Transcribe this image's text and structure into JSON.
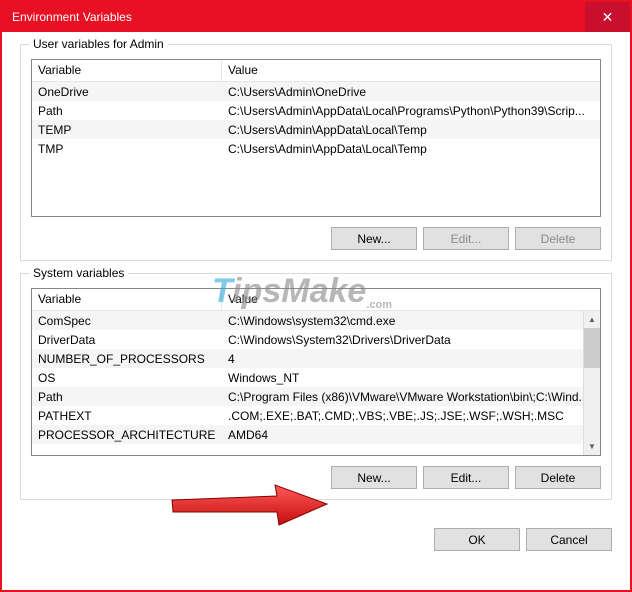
{
  "title": "Environment Variables",
  "user_section": {
    "label": "User variables for Admin",
    "columns": {
      "name": "Variable",
      "value": "Value"
    },
    "rows": [
      {
        "name": "OneDrive",
        "value": "C:\\Users\\Admin\\OneDrive"
      },
      {
        "name": "Path",
        "value": "C:\\Users\\Admin\\AppData\\Local\\Programs\\Python\\Python39\\Scrip..."
      },
      {
        "name": "TEMP",
        "value": "C:\\Users\\Admin\\AppData\\Local\\Temp"
      },
      {
        "name": "TMP",
        "value": "C:\\Users\\Admin\\AppData\\Local\\Temp"
      }
    ],
    "buttons": {
      "new": "New...",
      "edit": "Edit...",
      "delete": "Delete"
    }
  },
  "system_section": {
    "label": "System variables",
    "columns": {
      "name": "Variable",
      "value": "Value"
    },
    "rows": [
      {
        "name": "ComSpec",
        "value": "C:\\Windows\\system32\\cmd.exe"
      },
      {
        "name": "DriverData",
        "value": "C:\\Windows\\System32\\Drivers\\DriverData"
      },
      {
        "name": "NUMBER_OF_PROCESSORS",
        "value": "4"
      },
      {
        "name": "OS",
        "value": "Windows_NT"
      },
      {
        "name": "Path",
        "value": "C:\\Program Files (x86)\\VMware\\VMware Workstation\\bin\\;C:\\Wind..."
      },
      {
        "name": "PATHEXT",
        "value": ".COM;.EXE;.BAT;.CMD;.VBS;.VBE;.JS;.JSE;.WSF;.WSH;.MSC"
      },
      {
        "name": "PROCESSOR_ARCHITECTURE",
        "value": "AMD64"
      }
    ],
    "buttons": {
      "new": "New...",
      "edit": "Edit...",
      "delete": "Delete"
    }
  },
  "dialog_buttons": {
    "ok": "OK",
    "cancel": "Cancel"
  },
  "watermark": {
    "t": "T",
    "rest": "ipsMake",
    "com": ".com"
  }
}
